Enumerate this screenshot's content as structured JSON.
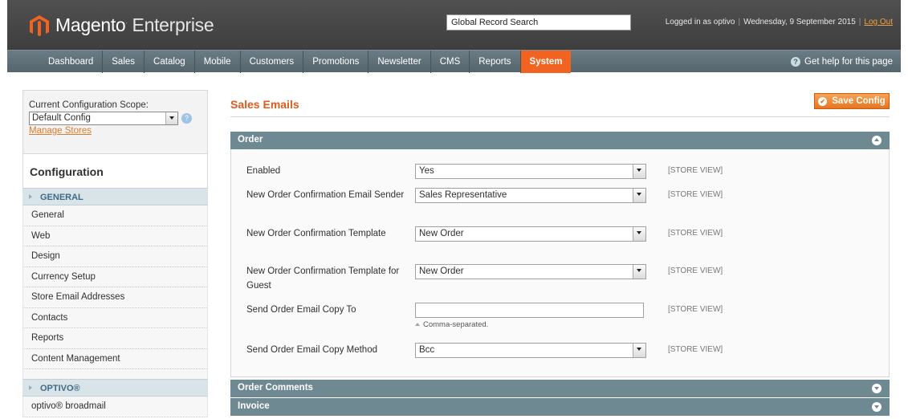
{
  "header": {
    "logo_brand": "Magento",
    "logo_product": "Enterprise",
    "search_value": "Global Record Search",
    "logged_in": "Logged in as optivo",
    "date": "Wednesday, 9 September 2015",
    "logout": "Log Out"
  },
  "nav": {
    "items": [
      "Dashboard",
      "Sales",
      "Catalog",
      "Mobile",
      "Customers",
      "Promotions",
      "Newsletter",
      "CMS",
      "Reports",
      "System"
    ],
    "active": "System",
    "help": "Get help for this page"
  },
  "sidebar": {
    "scope_label": "Current Configuration Scope:",
    "scope_value": "Default Config",
    "manage_stores": "Manage Stores",
    "config_title": "Configuration",
    "group_general": "GENERAL",
    "general_items": [
      "General",
      "Web",
      "Design",
      "Currency Setup",
      "Store Email Addresses",
      "Contacts",
      "Reports",
      "Content Management"
    ],
    "group_optivo": "OPTIVO®",
    "optivo_items": [
      "optivo® broadmail"
    ]
  },
  "main": {
    "title": "Sales Emails",
    "save_button": "Save Config",
    "section_order": "Order",
    "section_comments": "Order Comments",
    "section_invoice": "Invoice",
    "scope_tag": "[STORE VIEW]",
    "fields": [
      {
        "label": "Enabled",
        "value": "Yes",
        "type": "select"
      },
      {
        "label": "New Order Confirmation Email Sender",
        "value": "Sales Representative",
        "type": "select"
      },
      {
        "label": "New Order Confirmation Template",
        "value": "New Order",
        "type": "select"
      },
      {
        "label": "New Order Confirmation Template for Guest",
        "value": "New Order",
        "type": "select"
      },
      {
        "label": "Send Order Email Copy To",
        "value": "",
        "type": "text",
        "note": "Comma-separated."
      },
      {
        "label": "Send Order Email Copy Method",
        "value": "Bcc",
        "type": "select"
      }
    ]
  },
  "colors": {
    "accent": "#f26322",
    "title_orange": "#e05a1d",
    "section_head": "#6f8992",
    "nav_bg": "#5f717a"
  }
}
